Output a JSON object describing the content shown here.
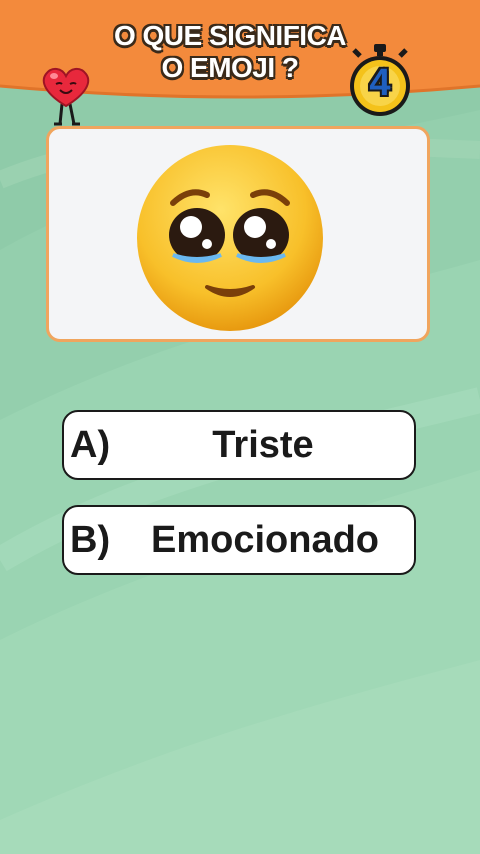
{
  "header": {
    "title_line1": "O QUE SIGNIFICA",
    "title_line2": "O EMOJI ?",
    "timer_value": "4"
  },
  "question": {
    "emoji_icon": "pleading-face-icon"
  },
  "answers": [
    {
      "letter": "A)",
      "text": "Triste"
    },
    {
      "letter": "B)",
      "text": "Emocionado"
    }
  ],
  "colors": {
    "header_orange": "#f38a3c",
    "background_green": "#8fcba9",
    "card_border": "#f0a55e",
    "timer_yellow": "#f4c21a"
  }
}
